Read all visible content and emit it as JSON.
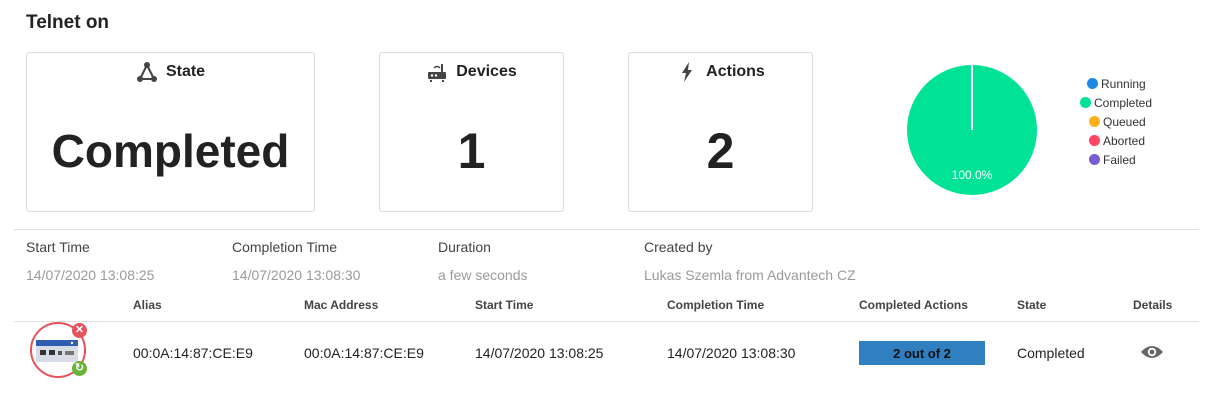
{
  "page_title": "Telnet on",
  "cards": {
    "state": {
      "label": "State",
      "value": "Completed",
      "icon": "network-icon"
    },
    "devices": {
      "label": "Devices",
      "value": "1",
      "icon": "router-icon"
    },
    "actions": {
      "label": "Actions",
      "value": "2",
      "icon": "lightning-icon"
    }
  },
  "chart_data": {
    "type": "pie",
    "slices": [
      {
        "label": "Running",
        "value": 0,
        "color": "#1e88e5"
      },
      {
        "label": "Completed",
        "value": 100,
        "color": "#00e396"
      },
      {
        "label": "Queued",
        "value": 0,
        "color": "#feb019"
      },
      {
        "label": "Aborted",
        "value": 0,
        "color": "#ff4560"
      },
      {
        "label": "Failed",
        "value": 0,
        "color": "#775dd0"
      }
    ],
    "data_label": "100.0%",
    "legend_position": "right"
  },
  "meta": {
    "start_time_label": "Start Time",
    "start_time_value": "14/07/2020 13:08:25",
    "completion_time_label": "Completion Time",
    "completion_time_value": "14/07/2020 13:08:30",
    "duration_label": "Duration",
    "duration_value": "a few seconds",
    "created_by_label": "Created by",
    "created_by_value": "Lukas Szemla from Advantech CZ"
  },
  "table": {
    "headers": [
      "Alias",
      "Mac Address",
      "Start Time",
      "Completion Time",
      "Completed Actions",
      "State",
      "Details"
    ],
    "rows": [
      {
        "alias": "00:0A:14:87:CE:E9",
        "mac": "00:0A:14:87:CE:E9",
        "start": "14/07/2020 13:08:25",
        "completion": "14/07/2020 13:08:30",
        "completed_actions": "2 out of 2",
        "completed_actions_fraction": 1.0,
        "state": "Completed",
        "details_icon": "eye-icon"
      }
    ]
  }
}
